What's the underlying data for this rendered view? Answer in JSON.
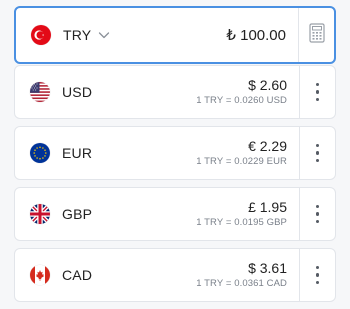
{
  "base": {
    "code": "TRY",
    "amount": "₺ 100.00",
    "flag_icon": "turkey-flag-icon",
    "dropdown_icon": "chevron-down-icon",
    "calculator_icon": "calculator-icon"
  },
  "currencies": [
    {
      "code": "USD",
      "amount": "$ 2.60",
      "rate": "1 TRY = 0.0260 USD",
      "flag_icon": "usa-flag-icon"
    },
    {
      "code": "EUR",
      "amount": "€ 2.29",
      "rate": "1 TRY = 0.0229 EUR",
      "flag_icon": "eu-flag-icon"
    },
    {
      "code": "GBP",
      "amount": "£ 1.95",
      "rate": "1 TRY = 0.0195 GBP",
      "flag_icon": "uk-flag-icon"
    },
    {
      "code": "CAD",
      "amount": "$ 3.61",
      "rate": "1 TRY = 0.0361 CAD",
      "flag_icon": "canada-flag-icon"
    }
  ],
  "colors": {
    "accent_border": "#4a90e2",
    "background": "#f6f7f9",
    "card": "#ffffff"
  }
}
